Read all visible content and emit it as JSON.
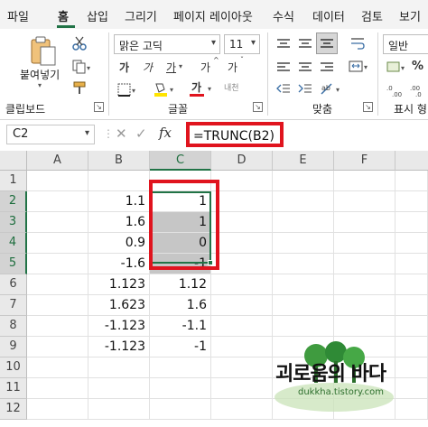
{
  "menu": {
    "tabs": [
      "파일",
      "홈",
      "삽입",
      "그리기",
      "페이지 레이아웃",
      "수식",
      "데이터",
      "검토",
      "보기"
    ],
    "active": "홈",
    "accent": "#217346"
  },
  "ribbon": {
    "clipboard": {
      "paste_label": "붙여넣기",
      "group_label": "클립보드"
    },
    "font": {
      "font_name": "맑은 고딕",
      "font_size": "11",
      "bold": "가",
      "italic": "가",
      "underline": "가",
      "grow": "가",
      "shrink": "가",
      "font_color": "가",
      "phonetic": "내천",
      "group_label": "글꼴"
    },
    "alignment": {
      "group_label": "맞춤"
    },
    "number": {
      "format": "일반",
      "group_label": "표시 형"
    }
  },
  "formula_bar": {
    "name_box": "C2",
    "cancel": "✕",
    "enter": "✓",
    "fx": "fx",
    "formula": "=TRUNC(B2)",
    "highlight_color": "#e0141e"
  },
  "grid": {
    "columns": [
      "A",
      "B",
      "C",
      "D",
      "E",
      "F"
    ],
    "selected_column": "C",
    "rows": [
      "1",
      "2",
      "3",
      "4",
      "5",
      "6",
      "7",
      "8",
      "9",
      "10",
      "11",
      "12"
    ],
    "b_values": [
      "",
      "1.1",
      "1.6",
      "0.9",
      "-1.6",
      "1.123",
      "1.623",
      "-1.123",
      "-1.123",
      "",
      "",
      ""
    ],
    "c_values": [
      "",
      "1",
      "1",
      "0",
      "-1",
      "1.12",
      "1.6",
      "-1.1",
      "-1",
      "",
      "",
      ""
    ]
  },
  "watermark": {
    "title": "괴로움의 바다",
    "url": "dukkha.tistory.com"
  }
}
